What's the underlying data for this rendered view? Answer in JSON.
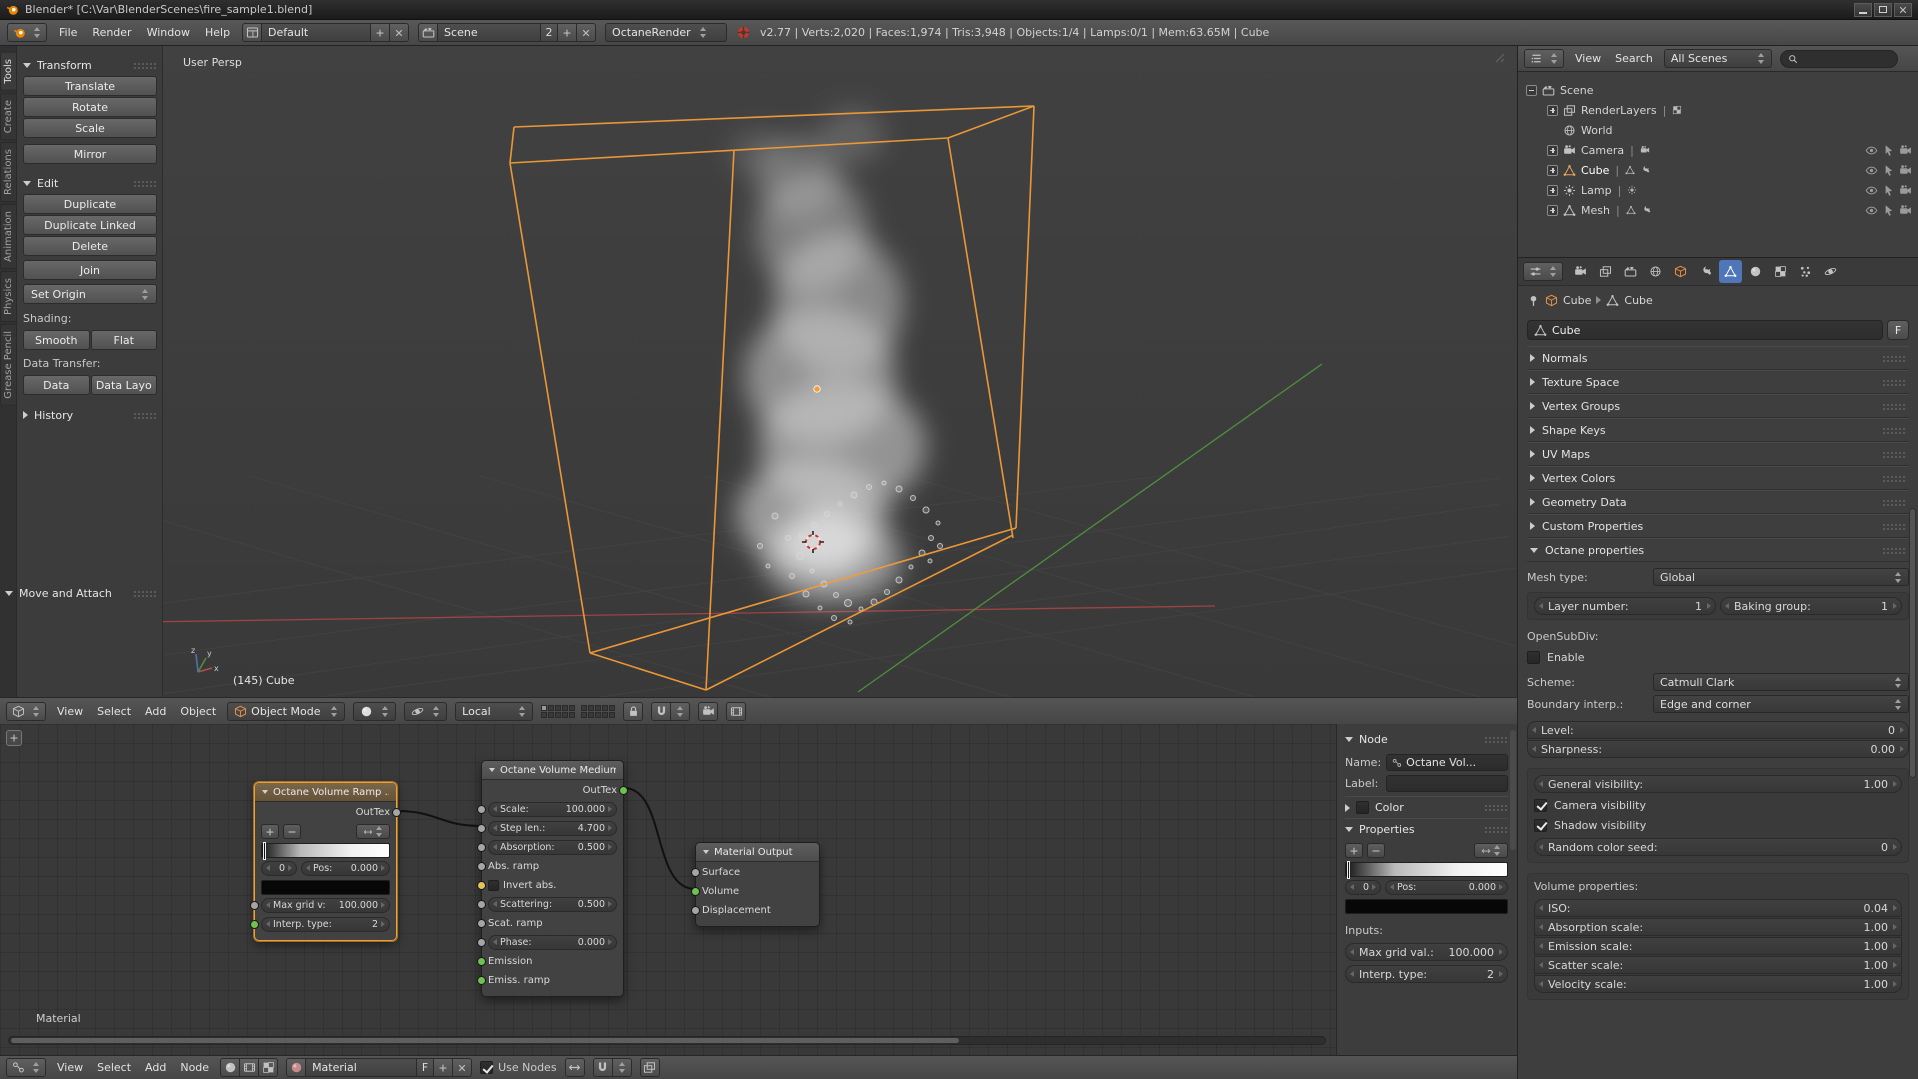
{
  "colors": {
    "accent": "#e8860c",
    "selected_outline": "#f0a030",
    "tab_active": "#4f76b8",
    "domain_wire": "#f49c36",
    "axis_red": "#9e4343",
    "axis_green": "#4e8f3e"
  },
  "titlebar": {
    "title": "Blender* [C:\\Var\\BlenderScenes\\fire_sample1.blend]"
  },
  "infobar": {
    "file": "File",
    "render": "Render",
    "window": "Window",
    "help": "Help",
    "layout": "Default",
    "scene": "Scene",
    "scene_users": "2",
    "engine": "OctaneRender",
    "stats": "v2.77 | Verts:2,020 | Faces:1,974 | Tris:3,948 | Objects:1/4 | Lamps:0/1 | Mem:63.65M | Cube"
  },
  "toolshelf": {
    "tab_tools": "Tools",
    "tab_create": "Create",
    "tab_relations": "Relations",
    "tab_animation": "Animation",
    "tab_physics": "Physics",
    "tab_grease_pencil": "Grease Pencil",
    "transform": "Transform",
    "translate": "Translate",
    "rotate": "Rotate",
    "scale": "Scale",
    "mirror": "Mirror",
    "edit": "Edit",
    "duplicate": "Duplicate",
    "duplicate_linked": "Duplicate Linked",
    "delete": "Delete",
    "join": "Join",
    "set_origin": "Set Origin",
    "shading": "Shading:",
    "smooth": "Smooth",
    "flat": "Flat",
    "data_transfer": "Data Transfer:",
    "data": "Data",
    "data_layo": "Data Layo",
    "history": "History",
    "move_and_attach": "Move and Attach"
  },
  "viewport": {
    "view_label": "User Persp",
    "object_label": "(145) Cube",
    "view": "View",
    "select": "Select",
    "add": "Add",
    "object": "Object",
    "mode": "Object Mode",
    "orientation": "Local",
    "axis_x": "x",
    "axis_y": "y",
    "axis_z": "z"
  },
  "outliner": {
    "view": "View",
    "search": "Search",
    "filter": "All Scenes",
    "scene": "Scene",
    "renderlayers": "RenderLayers",
    "world": "World",
    "camera": "Camera",
    "cube": "Cube",
    "lamp": "Lamp",
    "mesh": "Mesh"
  },
  "properties": {
    "object_name": "Cube",
    "data_name": "Cube",
    "name_value": "Cube",
    "fake_user": "F",
    "normals": "Normals",
    "texture_space": "Texture Space",
    "vertex_groups": "Vertex Groups",
    "shape_keys": "Shape Keys",
    "uv_maps": "UV Maps",
    "vertex_colors": "Vertex Colors",
    "geometry_data": "Geometry Data",
    "custom_properties": "Custom Properties",
    "octane": "Octane properties",
    "mesh_type_label": "Mesh type:",
    "mesh_type_value": "Global",
    "layer_number_label": "Layer number:",
    "layer_number_value": "1",
    "baking_group_label": "Baking group:",
    "baking_group_value": "1",
    "opensubdiv": "OpenSubDiv:",
    "enable": "Enable",
    "scheme_label": "Scheme:",
    "scheme_value": "Catmull Clark",
    "boundary_label": "Boundary interp.:",
    "boundary_value": "Edge and corner",
    "level_label": "Level:",
    "level_value": "0",
    "sharpness_label": "Sharpness:",
    "sharpness_value": "0.00",
    "general_visibility_label": "General visibility:",
    "general_visibility_value": "1.00",
    "camera_visibility": "Camera visibility",
    "shadow_visibility": "Shadow visibility",
    "random_seed_label": "Random color seed:",
    "random_seed_value": "0",
    "volume_properties": "Volume properties:",
    "iso_label": "ISO:",
    "iso_value": "0.04",
    "absorption_label": "Absorption scale:",
    "absorption_value": "1.00",
    "emission_label": "Emission scale:",
    "emission_value": "1.00",
    "scatter_label": "Scatter scale:",
    "scatter_value": "1.00",
    "velocity_label": "Velocity scale:",
    "velocity_value": "1.00"
  },
  "node_editor": {
    "view": "View",
    "select": "Select",
    "add": "Add",
    "node": "Node",
    "material": "Material",
    "fake_user": "F",
    "use_nodes": "Use Nodes",
    "tree_path": "Material",
    "ramp": {
      "title": "Octane Volume Ramp ...",
      "outtex": "OutTex",
      "index": "0",
      "pos_label": "Pos:",
      "pos_value": "0.000",
      "max_grid_label": "Max grid v:",
      "max_grid_value": "100.000",
      "interp_label": "Interp. type:",
      "interp_value": "2"
    },
    "medium": {
      "title": "Octane Volume Medium",
      "outtex": "OutTex",
      "scale_label": "Scale:",
      "scale_value": "100.000",
      "step_label": "Step len.:",
      "step_value": "4.700",
      "absorption_label": "Absorption:",
      "absorption_value": "0.500",
      "abs_ramp": "Abs. ramp",
      "invert_abs": "Invert abs.",
      "scattering_label": "Scattering:",
      "scattering_value": "0.500",
      "scat_ramp": "Scat. ramp",
      "phase_label": "Phase:",
      "phase_value": "0.000",
      "emission": "Emission",
      "emiss_ramp": "Emiss. ramp"
    },
    "output": {
      "title": "Material Output",
      "surface": "Surface",
      "volume": "Volume",
      "displacement": "Displacement"
    },
    "sidebar": {
      "node": "Node",
      "name_label": "Name:",
      "name_value": "Octane Vol...",
      "label_label": "Label:",
      "color": "Color",
      "properties": "Properties",
      "index": "0",
      "pos_label": "Pos:",
      "pos_value": "0.000",
      "inputs": "Inputs:",
      "max_grid_label": "Max grid val.:",
      "max_grid_value": "100.000",
      "interp_label": "Interp. type:",
      "interp_value": "2"
    }
  }
}
